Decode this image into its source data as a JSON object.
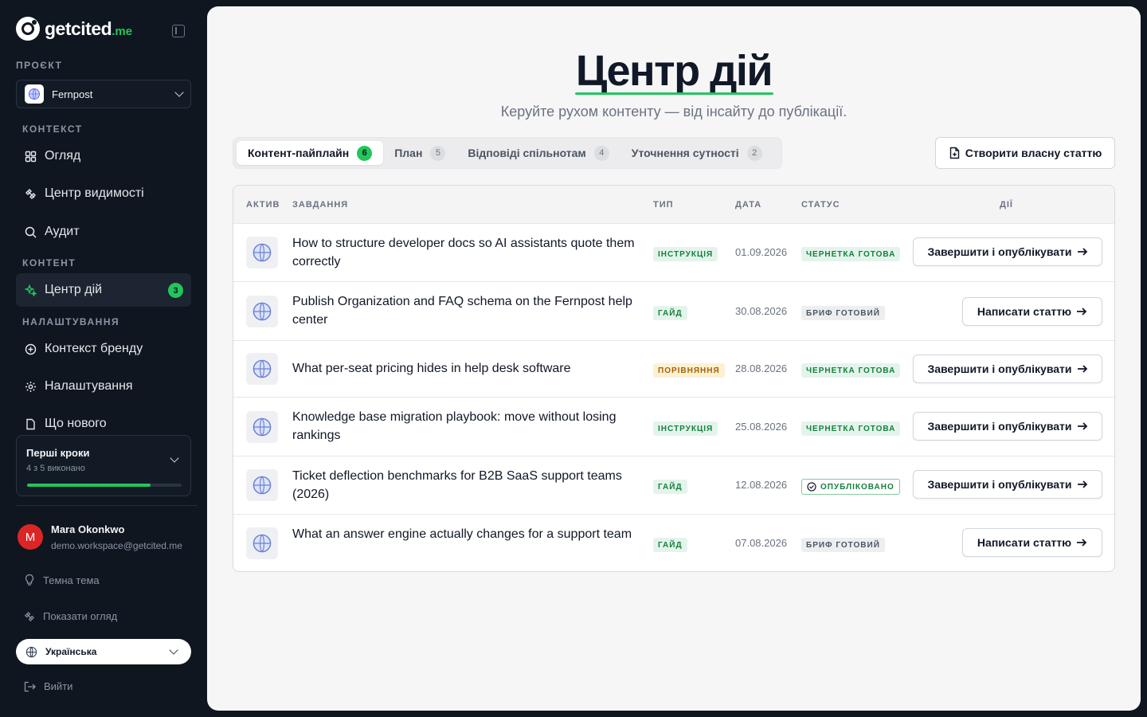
{
  "brand": {
    "name": "getcited",
    "tld": ".me"
  },
  "sidebar": {
    "project_label": "ПРОЄКТ",
    "project_name": "Fernpost",
    "sections": {
      "context": "КОНТЕКСТ",
      "content": "КОНТЕНТ",
      "settings": "НАЛАШТУВАННЯ"
    },
    "items": {
      "overview": "Огляд",
      "visibility": "Центр видимості",
      "audit": "Аудит",
      "action_center": "Центр дій",
      "action_center_badge": "3",
      "brand_context": "Контекст бренду",
      "settings": "Налаштування",
      "whats_new": "Що нового"
    },
    "getting_started": {
      "title": "Перші кроки",
      "progress_text": "4 з 5 виконано",
      "progress": 0.8
    },
    "user": {
      "initial": "M",
      "name": "Mara Okonkwo",
      "email": "demo.workspace@getcited.me"
    },
    "dark_theme": "Темна тема",
    "show_tour": "Показати огляд",
    "language": "Українська",
    "logout": "Вийти"
  },
  "main": {
    "title": "Центр дій",
    "subtitle": "Керуйте рухом контенту — від інсайту до публікації.",
    "tabs": [
      {
        "label": "Контент-пайплайн",
        "count": "6"
      },
      {
        "label": "План",
        "count": "5"
      },
      {
        "label": "Відповіді спільнотам",
        "count": "4"
      },
      {
        "label": "Уточнення сутності",
        "count": "2"
      }
    ],
    "create_button": "Створити власну статтю",
    "table": {
      "headers": {
        "asset": "АКТИВ",
        "task": "ЗАВДАННЯ",
        "type": "ТИП",
        "date": "ДАТА",
        "status": "СТАТУС",
        "actions": "ДІЇ"
      },
      "rows": [
        {
          "task": "How to structure developer docs so AI assistants quote them correctly",
          "type": "ІНСТРУКЦІЯ",
          "date": "01.09.2026",
          "status": "ЧЕРНЕТКА ГОТОВА",
          "action": "Завершити і опублікувати"
        },
        {
          "task": "Publish Organization and FAQ schema on the Fernpost help center",
          "type": "ГАЙД",
          "date": "30.08.2026",
          "status": "БРИФ ГОТОВИЙ",
          "action": "Написати статтю"
        },
        {
          "task": "What per-seat pricing hides in help desk software",
          "type": "ПОРІВНЯННЯ",
          "date": "28.08.2026",
          "status": "ЧЕРНЕТКА ГОТОВА",
          "action": "Завершити і опублікувати"
        },
        {
          "task": "Knowledge base migration playbook: move without losing rankings",
          "type": "ІНСТРУКЦІЯ",
          "date": "25.08.2026",
          "status": "ЧЕРНЕТКА ГОТОВА",
          "action": "Завершити і опублікувати"
        },
        {
          "task": "Ticket deflection benchmarks for B2B SaaS support teams (2026)",
          "type": "ГАЙД",
          "date": "12.08.2026",
          "status": "ОПУБЛІКОВАНО",
          "action": "Завершити і опублікувати"
        },
        {
          "task": "What an answer engine actually changes for a support team",
          "type": "ГАЙД",
          "date": "07.08.2026",
          "status": "БРИФ ГОТОВИЙ",
          "action": "Написати статтю"
        }
      ]
    }
  },
  "colors": {
    "accent": "#22c55e",
    "sidebar_bg": "#0f1620",
    "main_bg": "#f6f6f7"
  }
}
